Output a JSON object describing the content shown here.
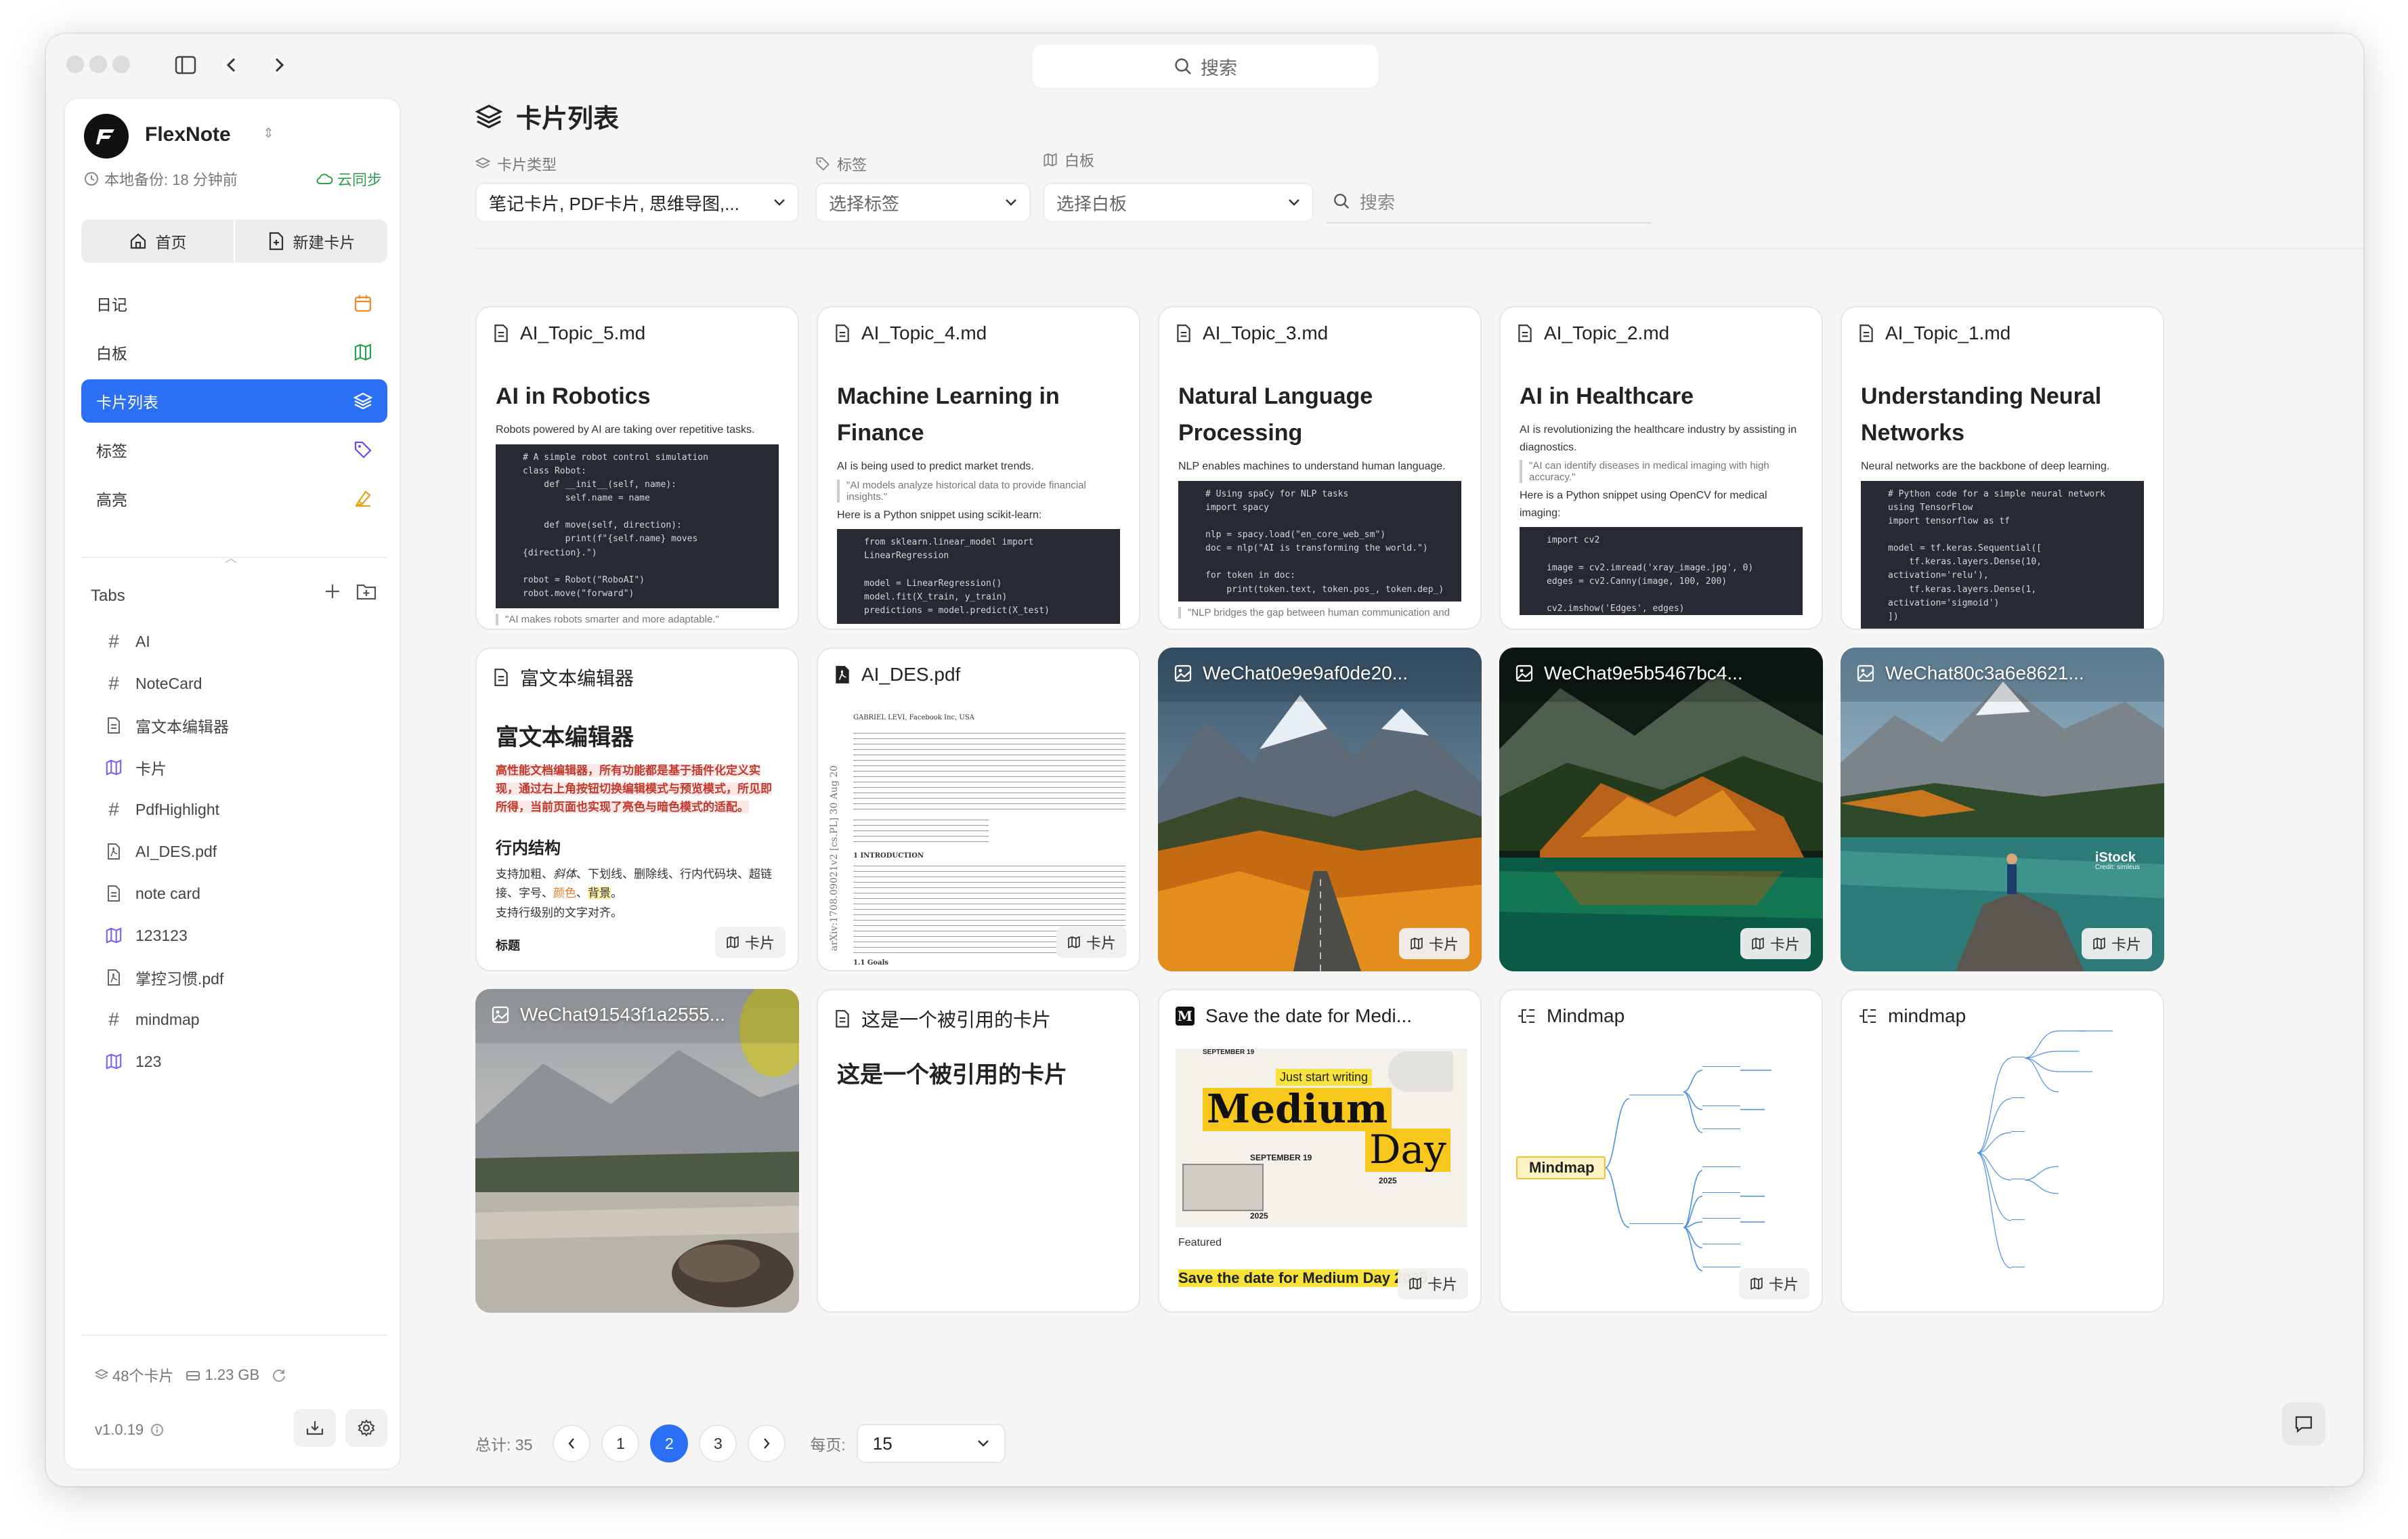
{
  "top_search": {
    "placeholder": "搜索"
  },
  "sidebar": {
    "app_name": "FlexNote",
    "backup": "本地备份: 18 分钟前",
    "cloud": "云同步",
    "home": "首页",
    "new_card": "新建卡片",
    "menu": [
      {
        "label": "日记",
        "icon": "calendar-icon"
      },
      {
        "label": "白板",
        "icon": "map-icon"
      },
      {
        "label": "卡片列表",
        "icon": "layers-icon"
      },
      {
        "label": "标签",
        "icon": "tag-icon"
      },
      {
        "label": "高亮",
        "icon": "highlighter-icon"
      }
    ],
    "tabs_title": "Tabs",
    "tabs": [
      {
        "label": "AI",
        "icon": "hash-icon"
      },
      {
        "label": "NoteCard",
        "icon": "hash-icon"
      },
      {
        "label": "富文本编辑器",
        "icon": "file-icon"
      },
      {
        "label": "卡片",
        "icon": "map-icon"
      },
      {
        "label": "PdfHighlight",
        "icon": "hash-icon"
      },
      {
        "label": "AI_DES.pdf",
        "icon": "pdf-icon"
      },
      {
        "label": "note card",
        "icon": "file-icon"
      },
      {
        "label": "123123",
        "icon": "map-icon"
      },
      {
        "label": "掌控习惯.pdf",
        "icon": "pdf-icon"
      },
      {
        "label": "mindmap",
        "icon": "hash-icon"
      },
      {
        "label": "123",
        "icon": "map-icon"
      }
    ],
    "card_count": "48个卡片",
    "storage": "1.23 GB",
    "version": "v1.0.19"
  },
  "main": {
    "title": "卡片列表",
    "filters": {
      "type_label": "卡片类型",
      "type_value": "笔记卡片, PDF卡片, 思维导图,...",
      "tag_label": "标签",
      "tag_placeholder": "选择标签",
      "board_label": "白板",
      "board_placeholder": "选择白板",
      "search_placeholder": "搜索"
    },
    "badge_label": "卡片",
    "cards": [
      {
        "file": "AI_Topic_5.md",
        "title": "AI in Robotics",
        "intro": "Robots powered by AI are taking over repetitive tasks.",
        "code": "# A simple robot control simulation\nclass Robot:\n    def __init__(self, name):\n        self.name = name\n\n    def move(self, direction):\n        print(f\"{self.name} moves\n{direction}.\")\n\nrobot = Robot(\"RoboAI\")\nrobot.move(\"forward\")",
        "quote": "\"AI makes robots smarter and more adaptable.\""
      },
      {
        "file": "AI_Topic_4.md",
        "title": "Machine Learning in Finance",
        "intro": "AI is being used to predict market trends.",
        "quote": "\"AI models analyze historical data to provide financial insights.\"",
        "intro2": "Here is a Python snippet using scikit-learn:",
        "code": "from sklearn.linear_model import\nLinearRegression\n\nmodel = LinearRegression()\nmodel.fit(X_train, y_train)\npredictions = model.predict(X_test)"
      },
      {
        "file": "AI_Topic_3.md",
        "title": "Natural Language Processing",
        "intro": "NLP enables machines to understand human language.",
        "code": "# Using spaCy for NLP tasks\nimport spacy\n\nnlp = spacy.load(\"en_core_web_sm\")\ndoc = nlp(\"AI is transforming the world.\")\n\nfor token in doc:\n    print(token.text, token.pos_, token.dep_)",
        "quote": "\"NLP bridges the gap between human communication and"
      },
      {
        "file": "AI_Topic_2.md",
        "title": "AI in Healthcare",
        "intro": "AI is revolutionizing the healthcare industry by assisting in diagnostics.",
        "quote": "\"AI can identify diseases in medical imaging with high accuracy.\"",
        "intro2": "Here is a Python snippet using OpenCV for medical imaging:",
        "code": "import cv2\n\nimage = cv2.imread('xray_image.jpg', 0)\nedges = cv2.Canny(image, 100, 200)\n\ncv2.imshow('Edges', edges)"
      },
      {
        "file": "AI_Topic_1.md",
        "title": "Understanding Neural Networks",
        "intro": "Neural networks are the backbone of deep learning.",
        "code": "# Python code for a simple neural network\nusing TensorFlow\nimport tensorflow as tf\n\nmodel = tf.keras.Sequential([\n    tf.keras.layers.Dense(10,\nactivation='relu'),\n    tf.keras.layers.Dense(1,\nactivation='sigmoid')\n])"
      },
      {
        "file": "富文本编辑器",
        "title": "富文本编辑器",
        "p1": "高性能文档编辑器，所有功能都是基于插件化定义实现，通过右上角按钮切换编辑模式与预览模式，所见即所得，当前页面也实现了亮色与暗色模式的适配。",
        "h2": "行内结构",
        "p2a": "支持加粗、",
        "p2b": "斜体",
        "p2c": "、下划线、删除线、行内代码块、超链接、字号、",
        "p2d": "颜色",
        "p2e": "、",
        "p2f": "背景",
        "p2g": "。",
        "p3": "支持行级别的文字对齐。",
        "h3": "标题"
      },
      {
        "file": "AI_DES.pdf",
        "pdf_author": "GABRIEL LEVI, Facebook Inc, USA",
        "pdf_side": "arXiv:1708.09021v2 [cs.PL] 30 Aug 20",
        "pdf_intro": "1 INTRODUCTION",
        "pdf_goals": "1.1 Goals"
      },
      {
        "file": "WeChat0e9e9af0de20..."
      },
      {
        "file": "WeChat9e5b5467bc4..."
      },
      {
        "file": "WeChat80c3a6e8621...",
        "watermark": "iStock",
        "credit": "Credit: simleus"
      },
      {
        "file": "WeChat91543f1a2555..."
      },
      {
        "file": "这是一个被引用的卡片",
        "title": "这是一个被引用的卡片"
      },
      {
        "file": "Save the date for Medi...",
        "m_top": "SEPTEMBER 19",
        "m_tag": "Just start writing",
        "m_big1": "Medium",
        "m_big2": "Day",
        "m_date": "SEPTEMBER 19",
        "m_year": "2025",
        "m_year2": "2025",
        "m_featured": "Featured",
        "m_caption": "Save the date for Medium Day 2025"
      },
      {
        "file": "Mindmap",
        "mm_root": "Mindmap"
      },
      {
        "file": "mindmap"
      }
    ],
    "pager": {
      "total": "总计: 35",
      "pages": [
        "1",
        "2",
        "3"
      ],
      "per_page_label": "每页:",
      "per_page": "15"
    }
  }
}
